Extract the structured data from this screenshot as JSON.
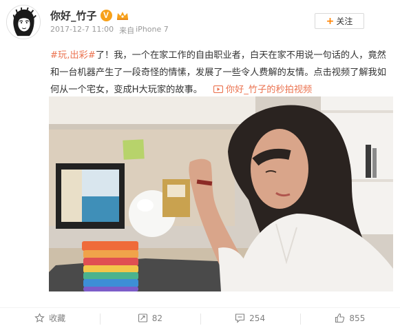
{
  "user": {
    "name": "你好_竹子",
    "verified_badge": "V",
    "member_icon": "vip-crown-icon"
  },
  "meta": {
    "timestamp": "2017-12-7 11:00",
    "source_prefix": "来自",
    "source_device": "iPhone 7"
  },
  "follow_button": {
    "label": "关注",
    "icon": "plus-icon"
  },
  "post": {
    "hashtag": "#玩,出彩#",
    "body": "了！我，一个在家工作的自由职业者，白天在家不用说一句话的人，竟然和一台机器产生了一段奇怪的情愫，发展了一些令人费解的友情。点击视频了解我如何从一个宅女，变成H大玩家的故事。",
    "video_link_label": "你好_竹子的秒拍视频",
    "video_link_icon": "video-play-icon"
  },
  "colors": {
    "accent": "#eb7350",
    "follow_plus": "#ff8200",
    "verify_badge": "#f7a11a"
  },
  "actions": {
    "favorite": {
      "label": "收藏",
      "icon": "star-icon"
    },
    "repost": {
      "count": "82",
      "icon": "repost-icon"
    },
    "comment": {
      "count": "254",
      "icon": "comment-icon"
    },
    "like": {
      "count": "855",
      "icon": "thumbs-up-icon"
    }
  }
}
